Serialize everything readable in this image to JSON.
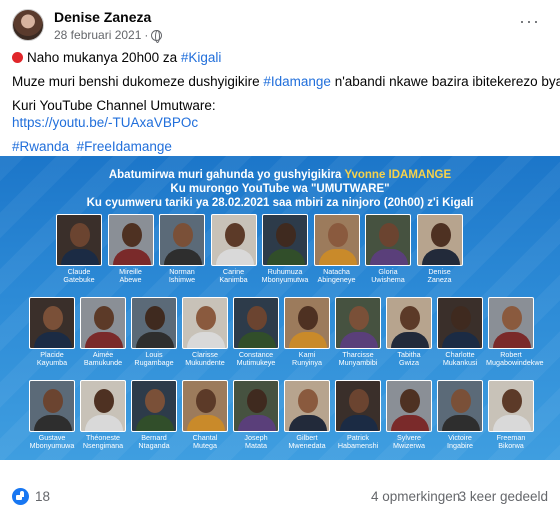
{
  "post": {
    "author": "Denise Zaneza",
    "date": "28 februari 2021",
    "date_separator": "·",
    "privacy_icon": "globe-icon",
    "more_label": "···"
  },
  "text": {
    "line1_prefix": "Naho mukanya 20h00 za ",
    "line1_tag": "#Kigali",
    "line2_prefix": "Muze muri benshi dukomeze dushyigikire ",
    "line2_tag": "#Idamange",
    "line2_suffix": " n'abandi nkawe bazira ibitekerezo byabo.",
    "line3": "Kuri YouTube Channel Umutware:",
    "link": "https://youtu.be/-TUAxaVBPOc",
    "tag_rwanda": "#Rwanda",
    "tag_freeidamange": "#FreeIdamange"
  },
  "poster": {
    "line1_prefix": "Abatumirwa muri gahunda yo gushyigikira ",
    "line1_highlight": "Yvonne IDAMANGE",
    "line2": "Ku murongo YouTube wa \"UMUTWARE\"",
    "line3": "Ku cyumweru tariki ya 28.02.2021 saa mbiri za ninjoro (20h00) z'i Kigali",
    "guests": [
      [
        "Claude",
        "Gatebuke"
      ],
      [
        "Mireille",
        "Abewe"
      ],
      [
        "Norman",
        "Ishimwe"
      ],
      [
        "Carine",
        "Kanimba"
      ],
      [
        "Ruhumuza",
        "Mbonyumutwa"
      ],
      [
        "Natacha",
        "Abingeneye"
      ],
      [
        "Gloria",
        "Uwishema"
      ],
      [
        "Denise",
        "Zaneza"
      ],
      [
        "Placide",
        "Kayumba"
      ],
      [
        "Aimée",
        "Bamukunde"
      ],
      [
        "Louis",
        "Rugambage"
      ],
      [
        "Clarisse",
        "Mukundente"
      ],
      [
        "Constance",
        "Mutimukeye"
      ],
      [
        "Kami",
        "Runyinya"
      ],
      [
        "Tharcisse",
        "Munyambibi"
      ],
      [
        "Tabitha",
        "Gwiza"
      ],
      [
        "Charlotte",
        "Mukankusi"
      ],
      [
        "Robert",
        "Mugabowindekwe"
      ],
      [
        "Gustave",
        "Mbonyumuwa"
      ],
      [
        "Théoneste",
        "Nsengimana"
      ],
      [
        "Bernard",
        "Ntaganda"
      ],
      [
        "Chantal",
        "Mutega"
      ],
      [
        "Joseph",
        "Matata"
      ],
      [
        "Gilbert",
        "Mwenedata"
      ],
      [
        "Patrick",
        "Habamenshi"
      ],
      [
        "Sylvere",
        "Mwizerwa"
      ],
      [
        "Victoire",
        "Ingabire"
      ],
      [
        "Freeman",
        "Bikorwa"
      ]
    ]
  },
  "footer": {
    "reaction_icon": "like-icon",
    "likes": "18",
    "comments": "4 opmerkingen",
    "shares": "3 keer gedeeld"
  },
  "colors": {
    "link": "#216fdb",
    "poster_bg": "#1c76c9",
    "highlight": "#f6d24a"
  }
}
